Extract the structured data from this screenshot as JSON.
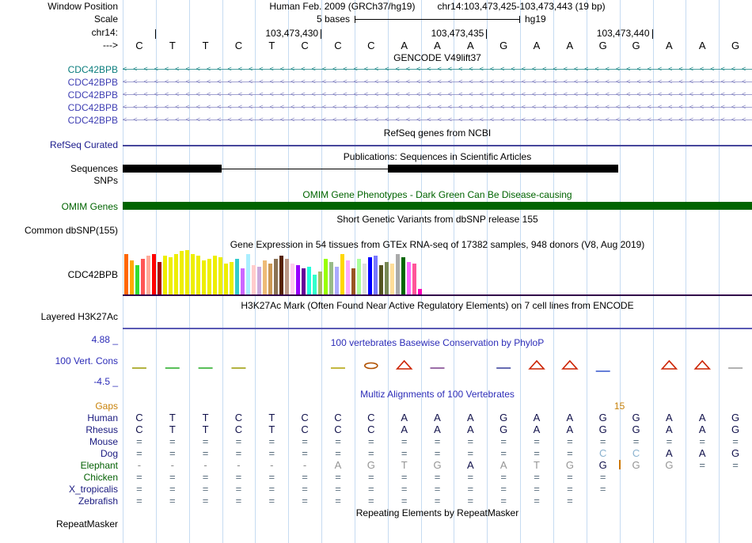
{
  "window": {
    "label": "Window Position",
    "assembly": "Human Feb. 2009 (GRCh37/hg19)",
    "position": "chr14:103,473,425-103,473,443 (19 bp)"
  },
  "ruler": {
    "scale_label": "Scale",
    "scale_value": "5 bases",
    "assembly_tag": "hg19",
    "chrom_label": "chr14:",
    "ticks": [
      {
        "boundary": 1,
        "label": ""
      },
      {
        "boundary": 6,
        "label": "103,473,430"
      },
      {
        "boundary": 11,
        "label": "103,473,435"
      },
      {
        "boundary": 16,
        "label": "103,473,440"
      }
    ],
    "strand_label": "--->",
    "bases": [
      "C",
      "T",
      "T",
      "C",
      "T",
      "C",
      "C",
      "C",
      "A",
      "A",
      "A",
      "G",
      "A",
      "A",
      "G",
      "G",
      "A",
      "A",
      "G"
    ]
  },
  "gencode": {
    "title": "GENCODE V49lift37",
    "transcripts": [
      {
        "label": "CDC42BPB",
        "label_color": "#0a7d7d",
        "arrow_color": "#0a7d7d"
      },
      {
        "label": "CDC42BPB",
        "label_color": "#4040b4",
        "arrow_color": "#8080c0"
      },
      {
        "label": "CDC42BPB",
        "label_color": "#4040b4",
        "arrow_color": "#8080c0"
      },
      {
        "label": "CDC42BPB",
        "label_color": "#4040b4",
        "arrow_color": "#8080c0"
      },
      {
        "label": "CDC42BPB",
        "label_color": "#4040b4",
        "arrow_color": "#8080c0"
      }
    ]
  },
  "refseq": {
    "title": "RefSeq genes from NCBI",
    "label": "RefSeq Curated",
    "line_color": "#46469c"
  },
  "publications": {
    "title": "Publications: Sequences in Scientific Articles",
    "sequences_label": "Sequences",
    "snps_label": "SNPs",
    "bars": [
      [
        0.0,
        0.157
      ],
      [
        0.421,
        0.787
      ]
    ],
    "connector": [
      0.157,
      0.421
    ]
  },
  "omim": {
    "title": "OMIM Gene Phenotypes - Dark Green Can Be Disease-causing",
    "label": "OMIM Genes",
    "color": "#006400"
  },
  "dbsnp": {
    "title": "Short Genetic Variants from dbSNP release 155",
    "label": "Common dbSNP(155)"
  },
  "gtex": {
    "title": "Gene Expression in 54 tissues from GTEx RNA-seq of 17382 samples, 948 donors (V8, Aug 2019)",
    "label": "CDC42BPB",
    "chart_data": {
      "type": "bar",
      "heights": [
        52,
        44,
        38,
        46,
        50,
        52,
        42,
        50,
        48,
        52,
        56,
        57,
        52,
        50,
        44,
        46,
        50,
        48,
        40,
        42,
        46,
        34,
        52,
        38,
        36,
        44,
        40,
        46,
        50,
        46,
        40,
        38,
        34,
        36,
        26,
        30,
        46,
        42,
        36,
        52,
        44,
        34,
        46,
        40,
        48,
        50,
        38,
        42,
        40,
        52,
        48,
        42,
        40,
        8
      ],
      "colors": [
        "#FF6600",
        "#FFAA00",
        "#33DD33",
        "#FF5555",
        "#FFAA99",
        "#FF0000",
        "#AA0000",
        "#EEEE00",
        "#EEEE00",
        "#EEEE00",
        "#EEEE00",
        "#EEEE00",
        "#EEEE00",
        "#EEEE00",
        "#EEEE00",
        "#EEEE00",
        "#EEEE00",
        "#EEEE00",
        "#EEEE00",
        "#EEEE00",
        "#33CCCC",
        "#CC66FF",
        "#AAEEFF",
        "#FFCCCC",
        "#CCAADD",
        "#EEBB77",
        "#CC9955",
        "#8B7355",
        "#552200",
        "#BB9988",
        "#FFCCEE",
        "#9900FF",
        "#660099",
        "#22FFDD",
        "#33FFCC",
        "#AABB66",
        "#99FF00",
        "#99BB88",
        "#AAAAFF",
        "#FFD700",
        "#FFAAFF",
        "#995522",
        "#AAFF99",
        "#DDDDDD",
        "#0000FF",
        "#7777FF",
        "#555522",
        "#778855",
        "#FFDD99",
        "#AAAAAA",
        "#006600",
        "#FF66FF",
        "#FF5599",
        "#FF00BB"
      ],
      "baseline_color": "#31004a"
    }
  },
  "h3k27ac": {
    "title": "H3K27Ac Mark (Often Found Near Active Regulatory Elements) on 7 cell lines from ENCODE",
    "label": "Layered H3K27Ac",
    "line_color": "#5a5ab4"
  },
  "conservation": {
    "title": "100 vertebrates Basewise Conservation by PhyloP",
    "label": "100 Vert. Cons",
    "max_label": "4.88 _",
    "min_label": "-4.5 _",
    "marks": [
      {
        "x": 0,
        "t": "dash",
        "c": "#9a9a00"
      },
      {
        "x": 1,
        "t": "dash",
        "c": "#22aa22"
      },
      {
        "x": 2,
        "t": "dash",
        "c": "#22aa22"
      },
      {
        "x": 3,
        "t": "dash",
        "c": "#9a9a00"
      },
      {
        "x": 6,
        "t": "dash",
        "c": "#b0a000"
      },
      {
        "x": 7,
        "t": "loop",
        "c": "#b05000"
      },
      {
        "x": 8,
        "t": "peak",
        "c": "#cc2200"
      },
      {
        "x": 9,
        "t": "dash",
        "c": "#7a3d8a"
      },
      {
        "x": 11,
        "t": "dash",
        "c": "#333a99"
      },
      {
        "x": 12,
        "t": "peak",
        "c": "#cc2200"
      },
      {
        "x": 13,
        "t": "peak",
        "c": "#cc2200"
      },
      {
        "x": 14,
        "t": "dip",
        "c": "#3355cc"
      },
      {
        "x": 16,
        "t": "peak",
        "c": "#cc2200"
      },
      {
        "x": 17,
        "t": "peak",
        "c": "#cc2200"
      },
      {
        "x": 18,
        "t": "dash",
        "c": "#999999"
      }
    ]
  },
  "multiz": {
    "title": "Multiz Alignments of 100 Vertebrates",
    "gaps": {
      "label": "Gaps",
      "count": "15",
      "boundary": 15
    },
    "rows": [
      {
        "name": "Human",
        "color": "#1a1a80",
        "seq": "CTTCTCCCAAAGAAGGAAG",
        "sty": "ddddddddddddddddddd"
      },
      {
        "name": "Rhesus",
        "color": "#1a1a80",
        "seq": "CTTCTCCCAAAGAAGGAAG",
        "sty": "ddddddddddddddddddd"
      },
      {
        "name": "Mouse",
        "color": "#1a1a80",
        "seq": "===================",
        "sty": "eeeeeeeeeeeeeeeeeee"
      },
      {
        "name": "Dog",
        "color": "#1a1a80",
        "seq": "==============CCAAG",
        "sty": "eeeeeeeeeeeeeellddd"
      },
      {
        "name": "Elephant",
        "color": "#056105",
        "seq": "------AGTGAATGGGG==",
        "sty": "aaaaaaggggdgggdggee",
        "insertion_boundary": 15
      },
      {
        "name": "Chicken",
        "color": "#056105",
        "seq": "===============    ",
        "sty": "eeeeeeeeeeeeeee    "
      },
      {
        "name": "X_tropicalis",
        "color": "#1a1a80",
        "seq": "===============    ",
        "sty": "eeeeeeeeeeeeeee    "
      },
      {
        "name": "Zebrafish",
        "color": "#1a1a80",
        "seq": "==============     ",
        "sty": "eeeeeeeeeeeeee     "
      }
    ]
  },
  "repeatmasker": {
    "title": "Repeating Elements by RepeatMasker",
    "label": "RepeatMasker"
  }
}
